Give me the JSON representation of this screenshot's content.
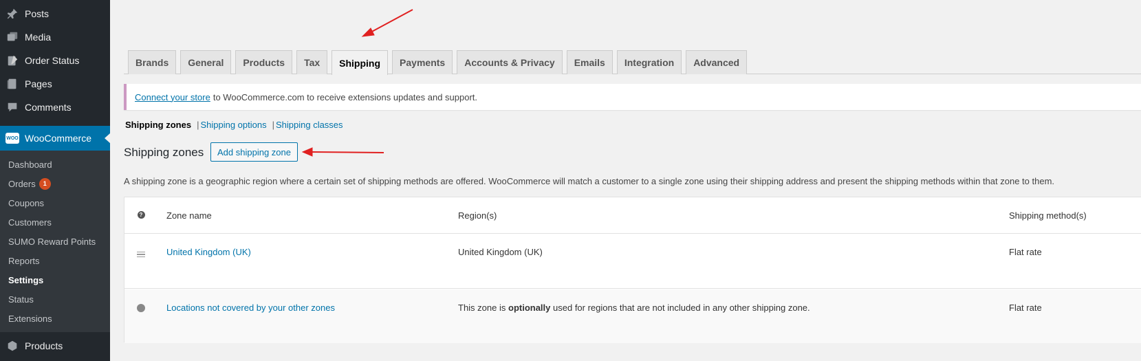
{
  "sidebar": {
    "top_items": [
      {
        "label": "Posts",
        "icon": "pin-icon"
      },
      {
        "label": "Media",
        "icon": "media-icon"
      },
      {
        "label": "Order Status",
        "icon": "order-status-icon"
      },
      {
        "label": "Pages",
        "icon": "pages-icon"
      },
      {
        "label": "Comments",
        "icon": "comments-icon"
      }
    ],
    "woocommerce": {
      "label": "WooCommerce",
      "logo_text": "WOO"
    },
    "submenu": [
      {
        "label": "Dashboard"
      },
      {
        "label": "Orders",
        "badge": "1"
      },
      {
        "label": "Coupons"
      },
      {
        "label": "Customers"
      },
      {
        "label": "SUMO Reward Points"
      },
      {
        "label": "Reports"
      },
      {
        "label": "Settings"
      },
      {
        "label": "Status"
      },
      {
        "label": "Extensions"
      }
    ],
    "products": {
      "label": "Products"
    }
  },
  "tabs": [
    "Brands",
    "General",
    "Products",
    "Tax",
    "Shipping",
    "Payments",
    "Accounts & Privacy",
    "Emails",
    "Integration",
    "Advanced"
  ],
  "active_tab": "Shipping",
  "notice": {
    "link": "Connect your store",
    "text": "to WooCommerce.com to receive extensions updates and support."
  },
  "subnav": {
    "current": "Shipping zones",
    "sep": "|",
    "links": [
      "Shipping options",
      "Shipping classes"
    ]
  },
  "zones": {
    "title": "Shipping zones",
    "add_button": "Add shipping zone",
    "description": "A shipping zone is a geographic region where a certain set of shipping methods are offered. WooCommerce will match a customer to a single zone using their shipping address and present the shipping methods within that zone to them."
  },
  "table": {
    "help_icon": "?",
    "headers": {
      "name": "Zone name",
      "region": "Region(s)",
      "method": "Shipping method(s)"
    },
    "row1": {
      "name": "United Kingdom (UK)",
      "region": "United Kingdom (UK)",
      "method": "Flat rate"
    },
    "row2": {
      "name": "Locations not covered by your other zones",
      "region_prefix": "This zone is",
      "region_bold": "optionally",
      "region_suffix": "used for regions that are not included in any other shipping zone.",
      "method": "Flat rate"
    }
  },
  "colors": {
    "sidebar_bg": "#23282d",
    "submenu_bg": "#32373c",
    "accent": "#0073aa",
    "annotation_arrow": "#e02020"
  }
}
